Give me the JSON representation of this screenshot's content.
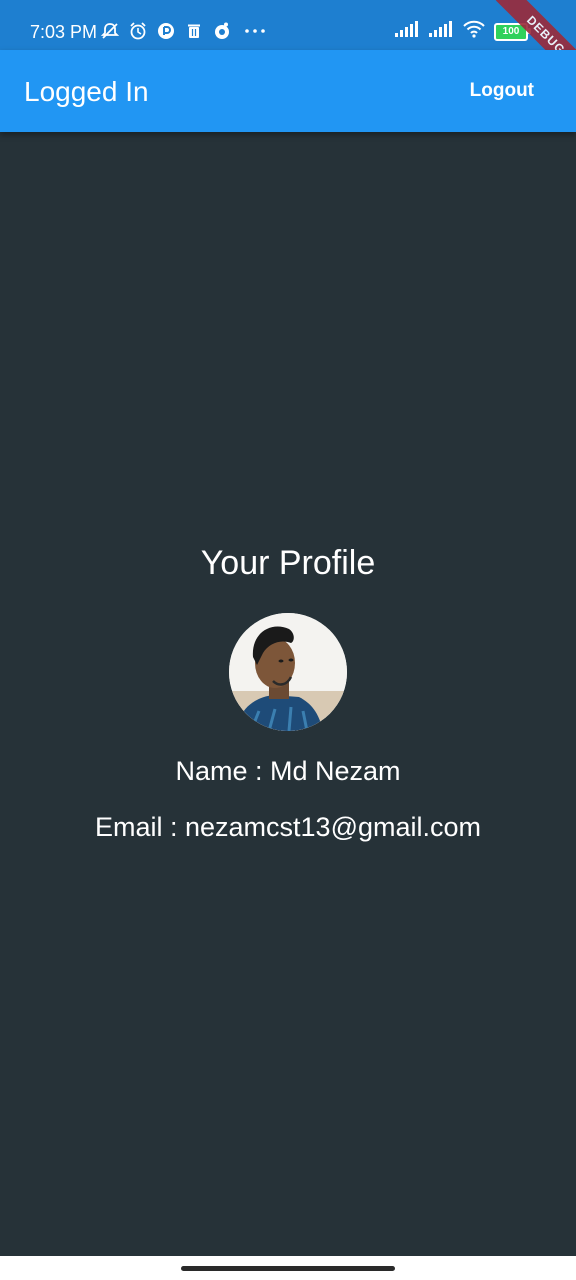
{
  "status_bar": {
    "time": "7:03 PM",
    "battery": "100",
    "icons": [
      "mute-icon",
      "alarm-icon",
      "app-icon",
      "trash-icon",
      "sync-icon",
      "more-dots-icon",
      "signal-icon",
      "signal-icon",
      "wifi-icon",
      "battery-icon"
    ]
  },
  "debug_banner": "DEBUG",
  "app_bar": {
    "title": "Logged In",
    "logout_label": "Logout",
    "color": "#2196f3"
  },
  "profile": {
    "heading": "Your Profile",
    "name_line": "Name : Md Nezam",
    "email_line": "Email : nezamcst13@gmail.com"
  },
  "colors": {
    "background": "#263238",
    "status_bar": "#1e7fd0"
  }
}
